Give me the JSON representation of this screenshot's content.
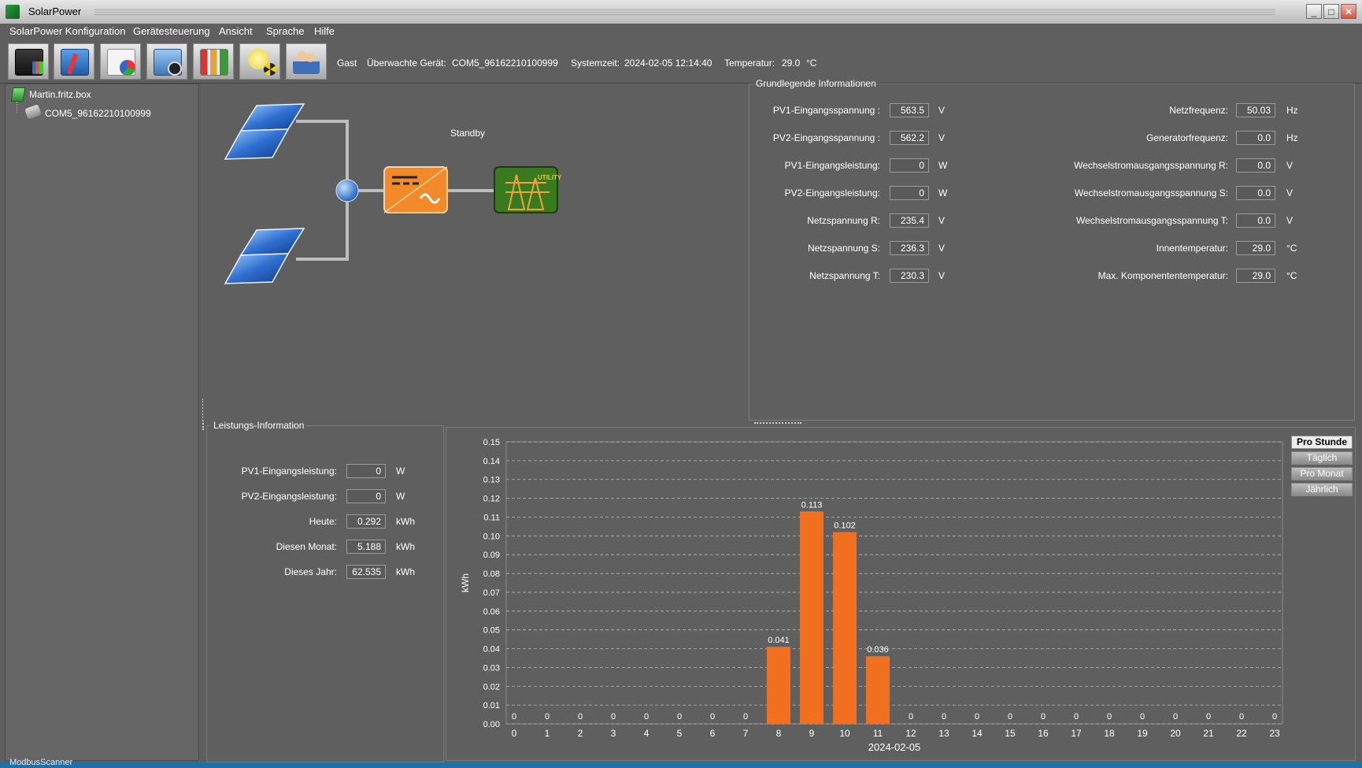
{
  "window": {
    "title": "SolarPower"
  },
  "menu": [
    "SolarPower Konfiguration",
    "Gerätesteuerung",
    "Ansicht",
    "Sprache",
    "Hilfe"
  ],
  "toolbar": {
    "buttons": [
      "monitor-icon",
      "config-icon",
      "report-icon",
      "camera-icon",
      "statistics-icon",
      "alarm-icon",
      "users-icon"
    ],
    "user": "Gast",
    "device_label": "Überwachte Gerät:",
    "device_value": "COM5_96162210100999",
    "time_label": "Systemzeit:",
    "time_value": "2024-02-05 12:14:40",
    "temp_label": "Temperatur:",
    "temp_value": "29.0",
    "temp_unit": "°C"
  },
  "tree": {
    "root": "Martin.fritz.box",
    "child": "COM5_96162210100999"
  },
  "diagram": {
    "status": "Standby",
    "utility_text": "UTILITY"
  },
  "basic_info": {
    "title": "Grundlegende Informationen",
    "left": [
      {
        "label": "PV1-Eingangsspannung :",
        "value": "563.5",
        "unit": "V"
      },
      {
        "label": "PV2-Eingangsspannung :",
        "value": "562.2",
        "unit": "V"
      },
      {
        "label": "PV1-Eingangsleistung:",
        "value": "0",
        "unit": "W"
      },
      {
        "label": "PV2-Eingangsleistung:",
        "value": "0",
        "unit": "W"
      },
      {
        "label": "Netzspannung R:",
        "value": "235.4",
        "unit": "V"
      },
      {
        "label": "Netzspannung S:",
        "value": "236.3",
        "unit": "V"
      },
      {
        "label": "Netzspannung T:",
        "value": "230.3",
        "unit": "V"
      }
    ],
    "right": [
      {
        "label": "Netzfrequenz:",
        "value": "50.03",
        "unit": "Hz"
      },
      {
        "label": "Generatorfrequenz:",
        "value": "0.0",
        "unit": "Hz"
      },
      {
        "label": "Wechselstromausgangsspannung R:",
        "value": "0.0",
        "unit": "V"
      },
      {
        "label": "Wechselstromausgangsspannung S:",
        "value": "0.0",
        "unit": "V"
      },
      {
        "label": "Wechselstromausgangsspannung T:",
        "value": "0.0",
        "unit": "V"
      },
      {
        "label": "Innentemperatur:",
        "value": "29.0",
        "unit": "°C"
      },
      {
        "label": "Max. Komponententemperatur:",
        "value": "29.0",
        "unit": "°C"
      }
    ]
  },
  "power_info": {
    "title": "Leistungs-Information",
    "rows": [
      {
        "label": "PV1-Eingangsleistung:",
        "value": "0",
        "unit": "W"
      },
      {
        "label": "PV2-Eingangsleistung:",
        "value": "0",
        "unit": "W"
      },
      {
        "label": "Heute:",
        "value": "0.292",
        "unit": "kWh"
      },
      {
        "label": "Diesen Monat:",
        "value": "5.188",
        "unit": "kWh"
      },
      {
        "label": "Dieses Jahr:",
        "value": "62.535",
        "unit": "kWh"
      }
    ]
  },
  "period_tabs": [
    {
      "label": "Pro Stunde",
      "active": true
    },
    {
      "label": "Täglich",
      "active": false
    },
    {
      "label": "Pro Monat",
      "active": false
    },
    {
      "label": "Jährlich",
      "active": false
    }
  ],
  "chart_data": {
    "type": "bar",
    "categories": [
      "0",
      "1",
      "2",
      "3",
      "4",
      "5",
      "6",
      "7",
      "8",
      "9",
      "10",
      "11",
      "12",
      "13",
      "14",
      "15",
      "16",
      "17",
      "18",
      "19",
      "20",
      "21",
      "22",
      "23"
    ],
    "values": [
      0,
      0,
      0,
      0,
      0,
      0,
      0,
      0,
      0.041,
      0.113,
      0.102,
      0.036,
      0,
      0,
      0,
      0,
      0,
      0,
      0,
      0,
      0,
      0,
      0,
      0
    ],
    "labels": [
      "0",
      "0",
      "0",
      "0",
      "0",
      "0",
      "0",
      "0",
      "0.041",
      "0.113",
      "0.102",
      "0.036",
      "0",
      "0",
      "0",
      "0",
      "0",
      "0",
      "0",
      "0",
      "0",
      "0",
      "0",
      "0"
    ],
    "ylabel": "kWh",
    "xlabel": "2024-02-05",
    "ylim": [
      0,
      0.15
    ],
    "yticks": [
      "0.00",
      "0.01",
      "0.02",
      "0.03",
      "0.04",
      "0.05",
      "0.06",
      "0.07",
      "0.08",
      "0.09",
      "0.10",
      "0.11",
      "0.12",
      "0.13",
      "0.14",
      "0.15"
    ],
    "bar_color": "#f07020",
    "grid": true
  },
  "taskbar": {
    "text": "ModbusScanner"
  }
}
